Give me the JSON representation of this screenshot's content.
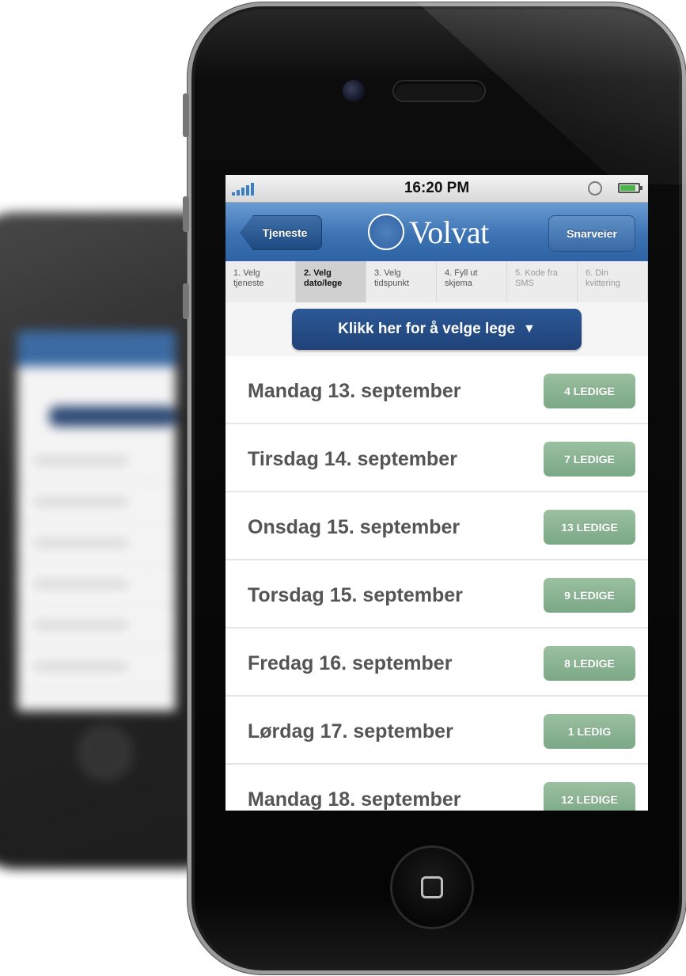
{
  "status_bar": {
    "time": "16:20 PM"
  },
  "nav": {
    "back_label": "Tjeneste",
    "logo_text": "Volvat",
    "shortcut_label": "Snarveier"
  },
  "steps": [
    {
      "label": "1. Velg tjeneste",
      "state": "done"
    },
    {
      "label": "2. Velg dato/lege",
      "state": "active"
    },
    {
      "label": "3. Velg tidspunkt",
      "state": "done"
    },
    {
      "label": "4. Fyll ut skjema",
      "state": "done"
    },
    {
      "label": "5. Kode fra SMS",
      "state": "todo"
    },
    {
      "label": "6. Din kvittering",
      "state": "todo"
    }
  ],
  "doctor_select": {
    "label": "Klikk her for å velge lege",
    "icon": "chevron-down-icon"
  },
  "days": [
    {
      "label": "Mandag 13. september",
      "slots": "4 LEDIGE"
    },
    {
      "label": "Tirsdag 14. september",
      "slots": "7 LEDIGE"
    },
    {
      "label": "Onsdag 15. september",
      "slots": "13 LEDIGE"
    },
    {
      "label": "Torsdag 15. september",
      "slots": "9 LEDIGE"
    },
    {
      "label": "Fredag 16. september",
      "slots": "8 LEDIGE"
    },
    {
      "label": "Lørdag 17. september",
      "slots": "1 LEDIG"
    },
    {
      "label": "Mandag 18. september",
      "slots": "12 LEDIGE"
    }
  ],
  "colors": {
    "nav_blue": "#3c73b3",
    "select_blue": "#1f4278",
    "badge_green": "#8bb594"
  }
}
